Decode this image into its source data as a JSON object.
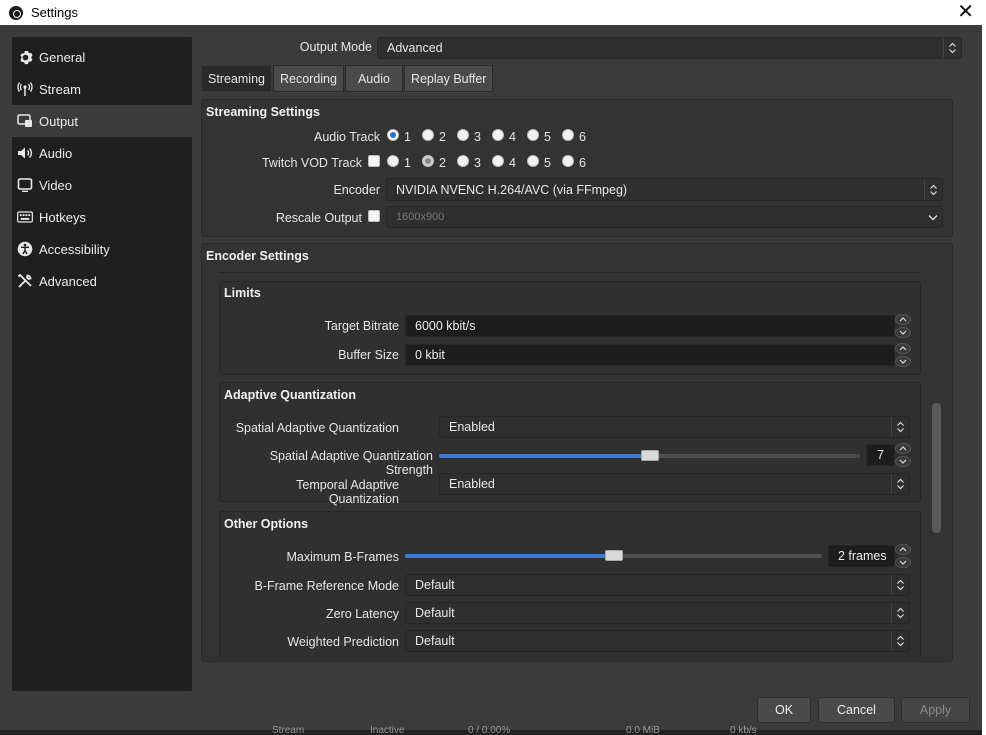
{
  "window": {
    "title": "Settings",
    "close_glyph": "✕"
  },
  "sidebar": {
    "items": [
      {
        "label": "General",
        "icon": "gear-icon"
      },
      {
        "label": "Stream",
        "icon": "antenna-icon"
      },
      {
        "label": "Output",
        "icon": "output-icon"
      },
      {
        "label": "Audio",
        "icon": "speaker-icon"
      },
      {
        "label": "Video",
        "icon": "monitor-icon"
      },
      {
        "label": "Hotkeys",
        "icon": "keyboard-icon"
      },
      {
        "label": "Accessibility",
        "icon": "accessibility-icon"
      },
      {
        "label": "Advanced",
        "icon": "wrench-icon"
      }
    ],
    "active_index": 2
  },
  "output_mode": {
    "label": "Output Mode",
    "value": "Advanced"
  },
  "tabs": [
    "Streaming",
    "Recording",
    "Audio",
    "Replay Buffer"
  ],
  "streaming": {
    "title": "Streaming Settings",
    "audio_track": {
      "label": "Audio Track",
      "options": [
        "1",
        "2",
        "3",
        "4",
        "5",
        "6"
      ],
      "selected": "1"
    },
    "twitch_vod": {
      "label": "Twitch VOD Track",
      "options": [
        "1",
        "2",
        "3",
        "4",
        "5",
        "6"
      ],
      "selected": "2",
      "enabled": false
    },
    "encoder": {
      "label": "Encoder",
      "value": "NVIDIA NVENC H.264/AVC (via FFmpeg)"
    },
    "rescale": {
      "label": "Rescale Output",
      "checked": false,
      "value": "1600x900"
    }
  },
  "encoder_settings": {
    "title": "Encoder Settings",
    "limits": {
      "title": "Limits",
      "target_bitrate": {
        "label": "Target Bitrate",
        "value": "6000 kbit/s"
      },
      "buffer_size": {
        "label": "Buffer Size",
        "value": "0 kbit"
      }
    },
    "aq": {
      "title": "Adaptive Quantization",
      "spatial": {
        "label": "Spatial Adaptive Quantization",
        "value": "Enabled"
      },
      "strength": {
        "label": "Spatial Adaptive Quantization Strength",
        "value": "7",
        "fraction": 0.5
      },
      "temporal": {
        "label": "Temporal Adaptive Quantization",
        "value": "Enabled"
      }
    },
    "other": {
      "title": "Other Options",
      "max_bframes": {
        "label": "Maximum B-Frames",
        "value": "2 frames",
        "fraction": 0.5
      },
      "bframe_ref": {
        "label": "B-Frame Reference Mode",
        "value": "Default"
      },
      "zero_latency": {
        "label": "Zero Latency",
        "value": "Default"
      },
      "weighted_pred": {
        "label": "Weighted Prediction",
        "value": "Default"
      }
    }
  },
  "buttons": {
    "ok": "OK",
    "cancel": "Cancel",
    "apply": "Apply"
  },
  "background_window": {
    "texts": [
      "Stream",
      "Inactive",
      "0 / 0.00%",
      "0.0 MiB",
      "0 kb/s"
    ]
  },
  "colors": {
    "accent": "#3b7bd5",
    "radio_selected": "#1f6fd6",
    "background": "#3b3b3b",
    "sidebar": "#1f1f1f"
  }
}
